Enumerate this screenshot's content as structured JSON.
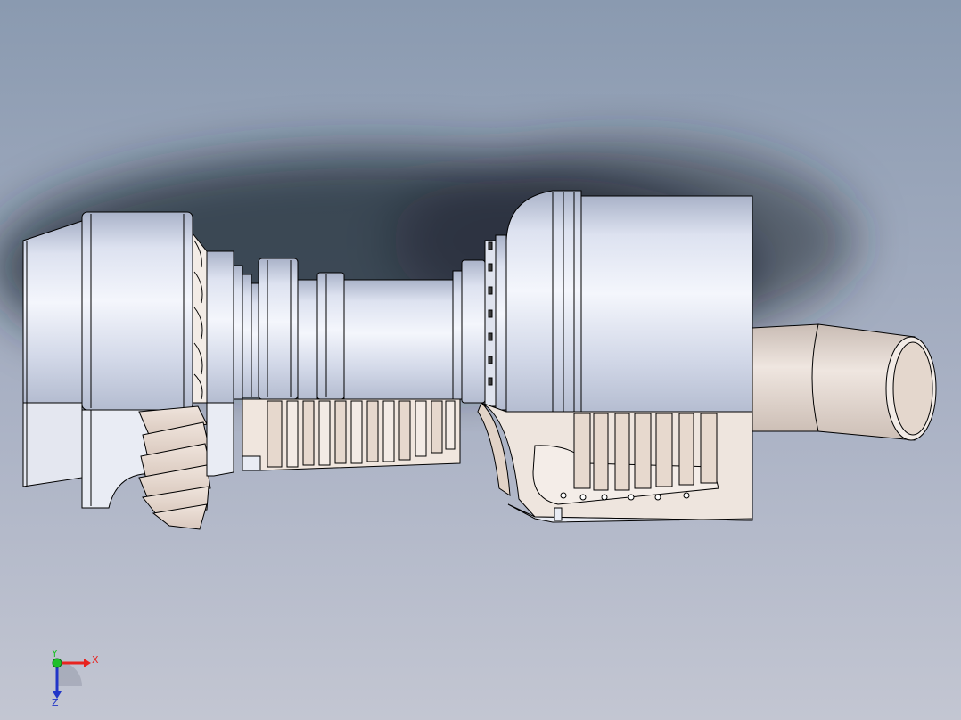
{
  "viewport": {
    "background_top": "#8e9eb2",
    "background_bottom": "#c4c8d4",
    "shadow_color": "#1e2630"
  },
  "model": {
    "shell_color": "#d6dcec",
    "shell_highlight": "#f2f5fc",
    "shell_shade": "#a9b2c8",
    "section_color": "#f1e8e2",
    "section_shade": "#cbb8ae",
    "outline_color": "#000000"
  },
  "triad": {
    "x_label": "X",
    "y_label": "Y",
    "z_label": "Z",
    "x_color": "#e8231f",
    "y_color": "#1fbf2a",
    "z_color": "#2135c8"
  }
}
